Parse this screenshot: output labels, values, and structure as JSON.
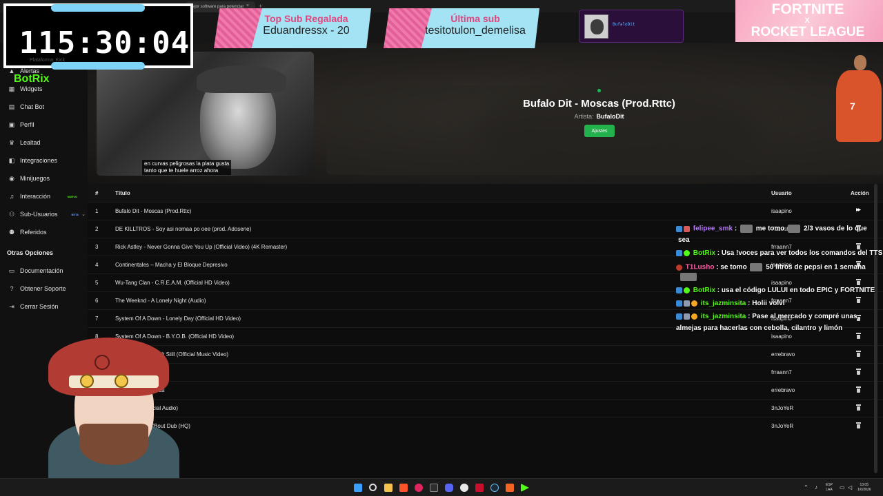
{
  "browser": {
    "tab_title": "mejor software para potenciar",
    "tab_close": "×",
    "tab_new": "+"
  },
  "sidebar": {
    "brand": "BotRix",
    "items": [
      {
        "label": "Alertas",
        "icon": "alert-icon"
      },
      {
        "label": "Widgets",
        "icon": "widgets-icon"
      },
      {
        "label": "Chat Bot",
        "icon": "chat-icon"
      },
      {
        "label": "Perfil",
        "icon": "profile-icon"
      },
      {
        "label": "Lealtad",
        "icon": "trophy-icon"
      },
      {
        "label": "Integraciones",
        "icon": "integrations-icon"
      },
      {
        "label": "Minijuegos",
        "icon": "gamepad-icon"
      },
      {
        "label": "Interacción",
        "icon": "music-icon",
        "badge": "NUEVO"
      },
      {
        "label": "Sub-Usuarios",
        "icon": "users-icon",
        "badge": "BETA"
      },
      {
        "label": "Referidos",
        "icon": "referrals-icon"
      }
    ],
    "section_title": "Otras Opciones",
    "other_items": [
      {
        "label": "Documentación",
        "icon": "docs-icon"
      },
      {
        "label": "Obtener Soporte",
        "icon": "help-icon"
      },
      {
        "label": "Cerrar Sesión",
        "icon": "logout-icon"
      }
    ]
  },
  "video": {
    "subtitle_line1": "en curvas peligrosas la plata gusta",
    "subtitle_line2": "tanto que te huele arroz ahora"
  },
  "now_playing": {
    "title": "Bufalo Dit - Moscas (Prod.Rttc)",
    "artist_label": "Artista:",
    "artist": "BufaloDit",
    "settings_button": "Ajustes"
  },
  "table": {
    "headers": {
      "num": "#",
      "title": "Título",
      "user": "Usuario",
      "action": "Acción"
    },
    "rows": [
      {
        "num": "1",
        "title": "Bufalo Dit - Moscas (Prod.Rttc)",
        "user": "isaapino",
        "action": "skip"
      },
      {
        "num": "2",
        "title": "DE KILLTROS - Soy asi nomaa po oee (prod. Adosene)",
        "user": "T1Lusho",
        "action": "delete"
      },
      {
        "num": "3",
        "title": "Rick Astley - Never Gonna Give You Up (Official Video) (4K Remaster)",
        "user": "frraann7",
        "action": "delete"
      },
      {
        "num": "4",
        "title": "Continentales – Macha y El Bloque Depresivo",
        "user": "isaapino",
        "action": "delete"
      },
      {
        "num": "5",
        "title": "Wu-Tang Clan - C.R.E.A.M. (Official HD Video)",
        "user": "isaapino",
        "action": "delete"
      },
      {
        "num": "6",
        "title": "The Weeknd - A Lonely Night (Audio)",
        "user": "frraann7",
        "action": "delete"
      },
      {
        "num": "7",
        "title": "System Of A Down - Lonely Day (Official HD Video)",
        "user": "isaapino",
        "action": "delete"
      },
      {
        "num": "8",
        "title": "System Of A Down - B.Y.O.B. (Official HD Video)",
        "user": "isaapino",
        "action": "delete"
      },
      {
        "num": "9",
        "title": "el. The Man - Feel It Still (Official Music Video)",
        "user": "errebravo",
        "action": "delete"
      },
      {
        "num": "10",
        "title": "~stay with me",
        "user": "frraann7",
        "action": "delete"
      },
      {
        "num": "11",
        "title": "ts Mono - Promesas",
        "user": "errebravo",
        "action": "delete"
      },
      {
        "num": "12",
        "title": "- Paranoid (Official Audio)",
        "user": "3nJoYeR",
        "action": "delete"
      },
      {
        "num": "13",
        "title": "O - Ain't Talkin' 'Bout Dub (HQ)",
        "user": "3nJoYeR",
        "action": "delete"
      }
    ]
  },
  "overlay": {
    "timer": "115:30:04",
    "timer_sub": "Plataforma: Kick",
    "top_sub_label": "Top Sub Regalada",
    "top_sub_value": "Eduandressx - 20",
    "last_sub_label": "Última sub",
    "last_sub_value": "tesitotulon_demelisa",
    "music_badge_name": "BufaloDit",
    "promo_line1": "FORTNITE",
    "promo_x": "X",
    "promo_line2": "ROCKET LEAGUE",
    "player_number": "7"
  },
  "chat": [
    {
      "user": "felipee_smk",
      "color": "purple",
      "text_a": " : ",
      "text_b": " me tomo ",
      "text_c": " 2/3 vasos de lo que",
      "cont": "sea"
    },
    {
      "user": "BotRix",
      "color": "green",
      "text": " : Usa !voces para ver todos los comandos del TTS"
    },
    {
      "user": "T1Lusho",
      "color": "pink",
      "text_a": " : se tomo ",
      "text_b": " 50 litros de pepsi en 1 semana"
    },
    {
      "user": "BotRix",
      "color": "green",
      "text": " : usa el código LULUI en todo EPIC y FORTNITE"
    },
    {
      "user": "its_jazminsita",
      "color": "green",
      "text": " : Holii volví"
    },
    {
      "user": "its_jazminsita",
      "color": "green",
      "text": " : Pase al mercado y compré unas",
      "cont": "almejas para hacerlas con cebolla, cilantro y limón"
    }
  ],
  "taskbar": {
    "lang_top": "ESP",
    "lang_bot": "LAA",
    "time": "13:05",
    "date": "1/6/2026"
  },
  "colors": {
    "kick_green": "#53fc18",
    "button_green": "#22b14c",
    "banner_blue": "#a4e3f3",
    "banner_pink": "#e35f97",
    "timer_bar": "#7fd3f7"
  }
}
